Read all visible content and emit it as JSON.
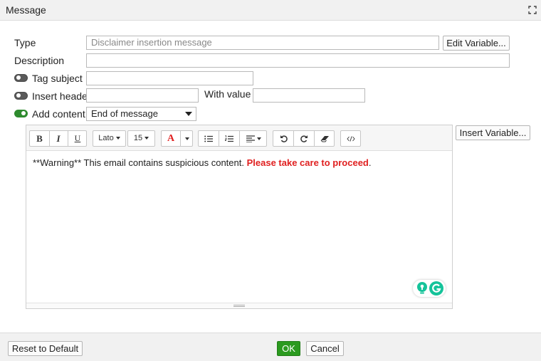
{
  "window": {
    "title": "Message"
  },
  "form": {
    "type_label": "Type",
    "type_placeholder": "Disclaimer insertion message",
    "edit_variable_label": "Edit Variable...",
    "description_label": "Description",
    "description_value": "",
    "tag_subject_label": "Tag subject",
    "tag_subject_enabled": false,
    "insert_header_label": "Insert header",
    "insert_header_enabled": false,
    "with_value_label": "With value",
    "add_content_label": "Add content",
    "add_content_enabled": true,
    "position_selected": "End of message"
  },
  "toolbar": {
    "bold": "B",
    "italic": "I",
    "underline": "U",
    "font": "Lato",
    "size": "15",
    "color_letter": "A"
  },
  "editor": {
    "text_plain": "**Warning** This email contains suspicious content.",
    "text_red": "Please take care to proceed",
    "text_end": ".",
    "insert_variable_label": "Insert Variable..."
  },
  "footer": {
    "reset_label": "Reset to Default",
    "ok_label": "OK",
    "cancel_label": "Cancel"
  },
  "colors": {
    "accent_green": "#2b9a1f",
    "warning_red": "#e02020",
    "grammarly": "#15c39a"
  }
}
